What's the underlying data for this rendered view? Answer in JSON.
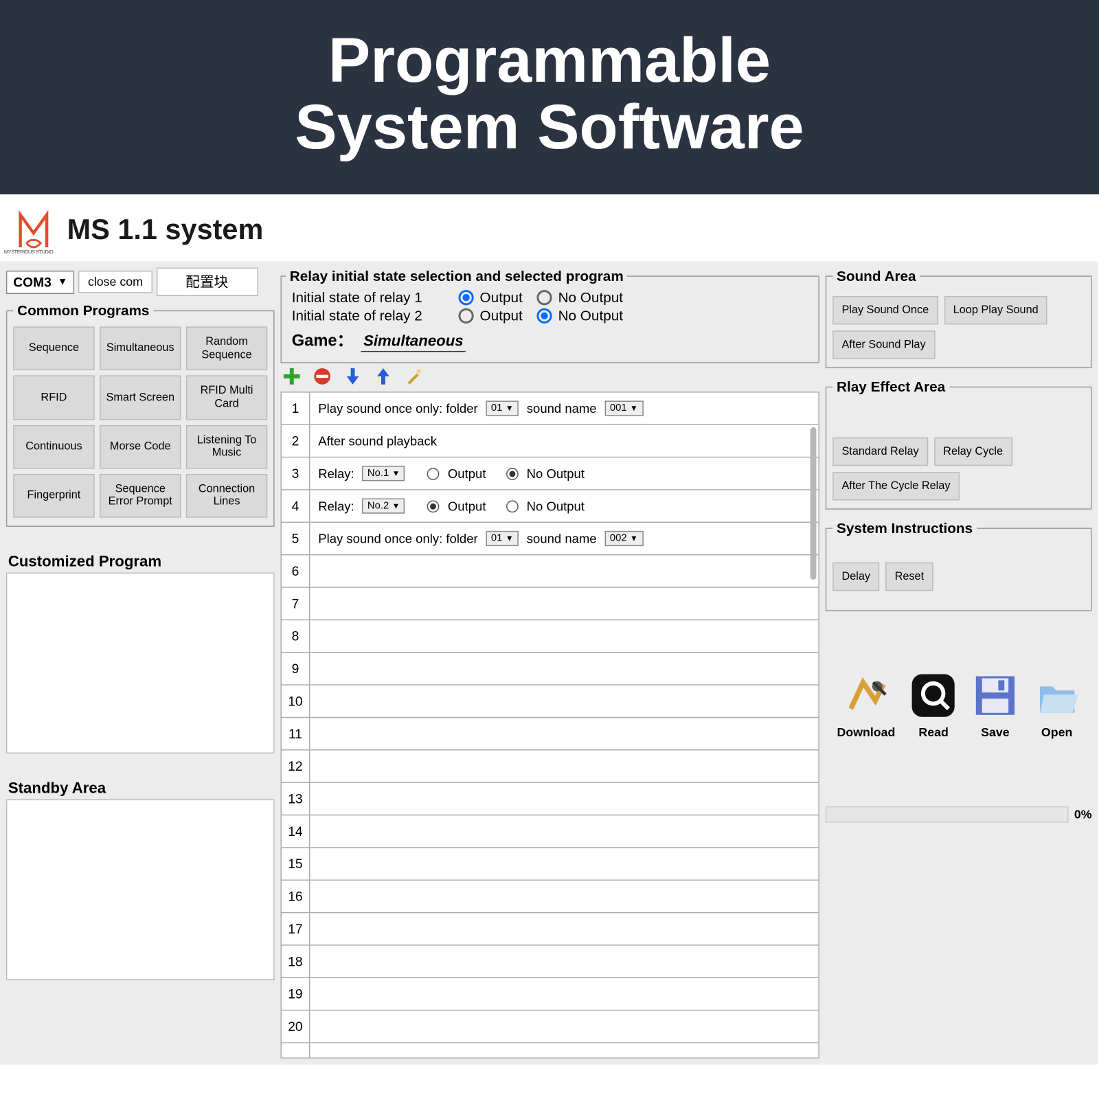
{
  "banner": {
    "line1": "Programmable",
    "line2": "System Software"
  },
  "app": {
    "title": "MS 1.1 system",
    "logo_sub": "MYSTERIOUS STUDIO"
  },
  "port": {
    "combo": "COM3",
    "close": "close  com",
    "config": "配置块"
  },
  "common_programs": {
    "legend": "Common Programs",
    "items": [
      "Sequence",
      "Simultaneous",
      "Random Sequence",
      "RFID",
      "Smart Screen",
      "RFID Multi Card",
      "Continuous",
      "Morse Code",
      "Listening To Music",
      "Fingerprint",
      "Sequence Error Prompt",
      "Connection Lines"
    ]
  },
  "custom": {
    "title": "Customized Program"
  },
  "standby": {
    "title": "Standby Area"
  },
  "relay_init": {
    "legend": "Relay initial state selection and selected program",
    "r1_label": "Initial state of relay 1",
    "r2_label": "Initial state of relay 2",
    "out": "Output",
    "noout": "No Output",
    "r1": "output",
    "r2": "nooutput",
    "game_label": "Game：",
    "game_value": "Simultaneous"
  },
  "rows": [
    {
      "n": 1,
      "type": "play",
      "text_a": "Play sound once only: folder",
      "folder": "01",
      "text_b": "sound name",
      "name": "001"
    },
    {
      "n": 2,
      "type": "text",
      "text": "After sound playback"
    },
    {
      "n": 3,
      "type": "relay",
      "label": "Relay:",
      "num": "No.1",
      "sel": "nooutput"
    },
    {
      "n": 4,
      "type": "relay",
      "label": "Relay:",
      "num": "No.2",
      "sel": "output"
    },
    {
      "n": 5,
      "type": "play",
      "text_a": "Play sound once only: folder",
      "folder": "01",
      "text_b": "sound name",
      "name": "002"
    },
    {
      "n": 6
    },
    {
      "n": 7
    },
    {
      "n": 8
    },
    {
      "n": 9
    },
    {
      "n": 10
    },
    {
      "n": 11
    },
    {
      "n": 12
    },
    {
      "n": 13
    },
    {
      "n": 14
    },
    {
      "n": 15
    },
    {
      "n": 16
    },
    {
      "n": 17
    },
    {
      "n": 18
    },
    {
      "n": 19
    },
    {
      "n": 20
    }
  ],
  "sound_area": {
    "legend": "Sound Area",
    "btns": [
      "Play Sound Once",
      "Loop Play Sound",
      "After Sound Play"
    ]
  },
  "relay_effect": {
    "legend": "Rlay Effect Area",
    "btns": [
      "Standard Relay",
      "Relay Cycle",
      "After The Cycle Relay"
    ]
  },
  "system_instr": {
    "legend": "System Instructions",
    "btns": [
      "Delay",
      "Reset"
    ]
  },
  "actions": {
    "download": "Download",
    "read": "Read",
    "save": "Save",
    "open": "Open"
  },
  "progress": {
    "pct": "0%"
  },
  "opt": {
    "output": "Output",
    "nooutput": "No Output"
  }
}
